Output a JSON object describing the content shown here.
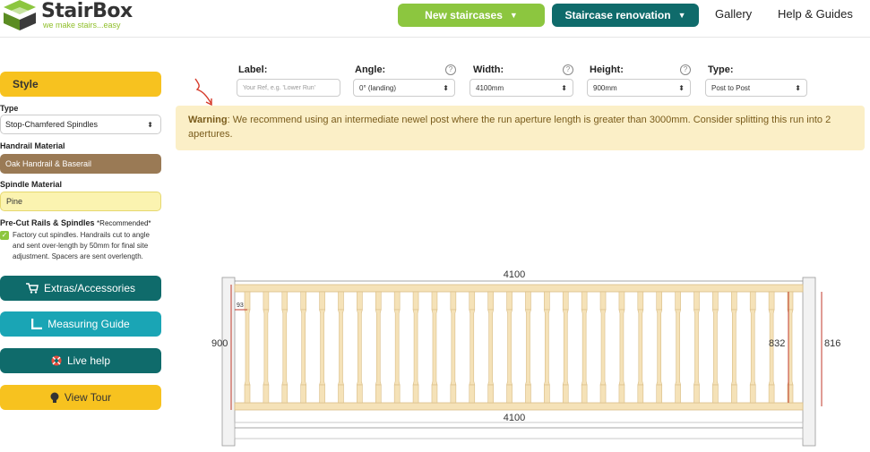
{
  "header": {
    "logo_title": "StairBox",
    "logo_tagline": "we make stairs...easy",
    "nav": {
      "new_staircases": "New staircases",
      "staircase_renovation": "Staircase renovation",
      "gallery": "Gallery",
      "help_guides": "Help & Guides"
    }
  },
  "sidebar": {
    "style_label": "Style",
    "type_label": "Type",
    "type_value": "Stop-Chamfered Spindles",
    "handrail_label": "Handrail Material",
    "handrail_value": "Oak Handrail & Baserail",
    "spindle_label": "Spindle Material",
    "spindle_value": "Pine",
    "precut_title": "Pre-Cut Rails & Spindles",
    "precut_recommended": "*Recommended*",
    "precut_checked": true,
    "precut_description": "Factory cut spindles. Handrails cut to angle and sent over-length by 50mm for final site adjustment. Spacers are sent overlength.",
    "extras_label": "Extras/Accessories",
    "measuring_label": "Measuring Guide",
    "livehelp_label": "Live help",
    "tour_label": "View Tour"
  },
  "config": {
    "label_heading": "Label:",
    "label_placeholder": "Your Ref, e.g. 'Lower Run'",
    "angle_heading": "Angle:",
    "angle_value": "0° (landing)",
    "width_heading": "Width:",
    "width_value": "4100mm",
    "height_heading": "Height:",
    "height_value": "900mm",
    "type_heading": "Type:",
    "type_value": "Post to Post"
  },
  "warning": {
    "prefix": "Warning",
    "text": ": We recommend using an intermediate newel post where the run aperture length is greater than 3000mm. Consider splitting this run into 2 apertures."
  },
  "diagram": {
    "top_width_label": "4100",
    "bottom_width_label": "4100",
    "left_height_label": "900",
    "inner_height_label": "832",
    "right_height_label": "816",
    "gap_label": "93",
    "spindle_count": 30,
    "colors": {
      "wood": "#f5e2b8",
      "wood_edge": "#d9bd86",
      "post": "#f2f2f2",
      "dimension": "#c0392b"
    }
  },
  "colors": {
    "green": "#8cc63f",
    "teal": "#0f6b6b",
    "yellow": "#f7c21f",
    "cyan": "#1aa5b5"
  }
}
